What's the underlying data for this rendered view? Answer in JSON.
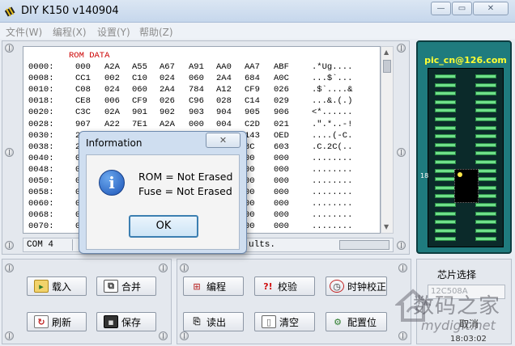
{
  "window": {
    "title": "DIY K150 v140904"
  },
  "menu": [
    "文件(W)",
    "编程(X)",
    "设置(Y)",
    "帮助(Z)"
  ],
  "memo": {
    "label": "ROM DATA",
    "rows": [
      {
        "addr": "0000:",
        "cols": [
          "000",
          "A2A",
          "A55",
          "A67",
          "A91",
          "AA0",
          "AA7",
          "ABF"
        ],
        "ascii": ".*Ug...."
      },
      {
        "addr": "0008:",
        "cols": [
          "CC1",
          "002",
          "C10",
          "024",
          "060",
          "2A4",
          "684",
          "A0C"
        ],
        "ascii": "...$`..."
      },
      {
        "addr": "0010:",
        "cols": [
          "C08",
          "024",
          "060",
          "2A4",
          "784",
          "A12",
          "CF9",
          "026"
        ],
        "ascii": ".$`....&"
      },
      {
        "addr": "0018:",
        "cols": [
          "CE8",
          "006",
          "CF9",
          "026",
          "C96",
          "028",
          "C14",
          "029"
        ],
        "ascii": "...&.(.)"
      },
      {
        "addr": "0020:",
        "cols": [
          "C3C",
          "02A",
          "901",
          "902",
          "903",
          "904",
          "905",
          "906"
        ],
        "ascii": "<*......"
      },
      {
        "addr": "0028:",
        "cols": [
          "907",
          "A22",
          "7E1",
          "A2A",
          "000",
          "004",
          "C2D",
          "021"
        ],
        "ascii": ".\".*..-!"
      },
      {
        "addr": "0030:",
        "cols": [
          "2",
          "",
          "",
          "",
          "",
          "",
          "143",
          "OED"
        ],
        "ascii": "....(-C."
      },
      {
        "addr": "0038:",
        "cols": [
          "2",
          "",
          "",
          "",
          "",
          "",
          "8C",
          "603"
        ],
        "ascii": ".C.2C(.."
      },
      {
        "addr": "0040:",
        "cols": [
          "0",
          "",
          "",
          "",
          "",
          "",
          "00",
          "000"
        ],
        "ascii": "........"
      },
      {
        "addr": "0048:",
        "cols": [
          "0",
          "",
          "",
          "",
          "",
          "",
          "00",
          "000"
        ],
        "ascii": "........"
      },
      {
        "addr": "0050:",
        "cols": [
          "0",
          "",
          "",
          "",
          "",
          "",
          "00",
          "000"
        ],
        "ascii": "........"
      },
      {
        "addr": "0058:",
        "cols": [
          "0",
          "",
          "",
          "",
          "",
          "",
          "00",
          "000"
        ],
        "ascii": "........"
      },
      {
        "addr": "0060:",
        "cols": [
          "0",
          "",
          "",
          "",
          "",
          "",
          "00",
          "000"
        ],
        "ascii": "........"
      },
      {
        "addr": "0068:",
        "cols": [
          "0",
          "",
          "",
          "",
          "",
          "",
          "00",
          "000"
        ],
        "ascii": "........"
      },
      {
        "addr": "0070:",
        "cols": [
          "0",
          "",
          "",
          "",
          "",
          "",
          "00",
          "000"
        ],
        "ascii": "........"
      },
      {
        "addr": "0078:",
        "cols": [
          "0",
          "",
          "",
          "",
          "",
          "",
          "00",
          "000"
        ],
        "ascii": "........"
      }
    ]
  },
  "status": {
    "port": "COM 4",
    "message": "ults."
  },
  "chip": {
    "title": "pic_cn@126.com",
    "pin_marker": "18",
    "select_label": "芯片选择",
    "model": "12C508A",
    "cancel_label": "取消",
    "clock": "18:03:02"
  },
  "buttons": {
    "load": "载入",
    "merge": "合并",
    "program": "编程",
    "verify": "校验",
    "clock_cal": "时钟校正",
    "refresh": "刷新",
    "save": "保存",
    "read": "读出",
    "erase": "清空",
    "config": "配置位"
  },
  "dialog": {
    "title": "Information",
    "line1": "ROM = Not Erased",
    "line2": "Fuse = Not Erased",
    "ok": "OK",
    "close": "✕"
  },
  "watermark": {
    "main": "数码之家",
    "url": "mydigit.net"
  }
}
